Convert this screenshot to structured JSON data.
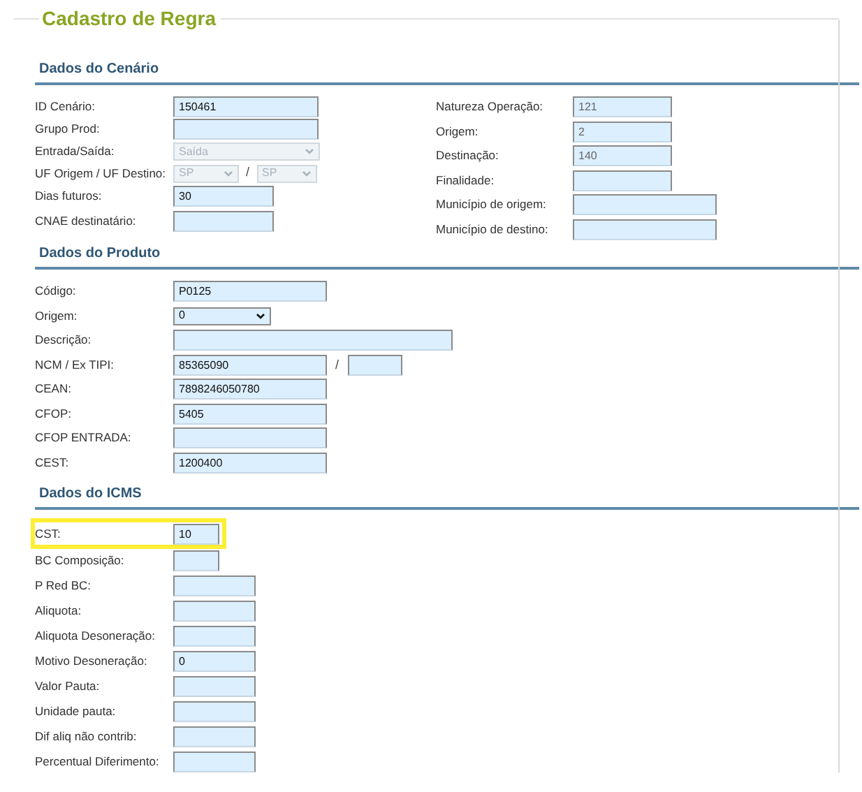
{
  "title": "Cadastro de Regra",
  "sections": [
    {
      "title": "Dados do Cenário",
      "columns": [
        [
          {
            "kind": "text",
            "label": "ID Cenário:",
            "value": "150461"
          },
          {
            "kind": "text",
            "label": "Grupo Prod:"
          },
          {
            "kind": "select",
            "label": "Entrada/Saída:",
            "value": "Saída",
            "disabled": true
          },
          {
            "kind": "select_pair",
            "label": "UF Origem / UF Destino:",
            "value": "SP",
            "separator": "/",
            "value2": "SP",
            "disabled": true
          },
          {
            "kind": "text",
            "label": "Dias futuros:",
            "value": "30"
          },
          {
            "kind": "text",
            "label": "CNAE destinatário:"
          }
        ],
        [
          {
            "kind": "text",
            "label": "Natureza Operação:",
            "value": "121",
            "disabled": true
          },
          {
            "kind": "text",
            "label": "Origem:",
            "value": "2",
            "disabled": true
          },
          {
            "kind": "text",
            "label": "Destinação:",
            "value": "140",
            "disabled": true
          },
          {
            "kind": "text",
            "label": "Finalidade:"
          },
          {
            "kind": "text",
            "label": "Município de origem:"
          },
          {
            "kind": "text",
            "label": "Município de destino:"
          }
        ]
      ]
    },
    {
      "title": "Dados do Produto",
      "columns": [
        [
          {
            "kind": "text",
            "label": "Código:",
            "value": "P0125"
          },
          {
            "kind": "select",
            "label": "Origem:",
            "value": "0",
            "disabled": false
          },
          {
            "kind": "text",
            "label": "Descrição:"
          },
          {
            "kind": "text_pair",
            "label": "NCM / Ex TIPI:",
            "value": "85365090",
            "separator": "/"
          },
          {
            "kind": "text",
            "label": "CEAN:",
            "value": "7898246050780"
          },
          {
            "kind": "text",
            "label": "CFOP:",
            "value": "5405"
          },
          {
            "kind": "text",
            "label": "CFOP ENTRADA:"
          },
          {
            "kind": "text",
            "label": "CEST:",
            "value": "1200400"
          }
        ]
      ]
    },
    {
      "title": "Dados do ICMS",
      "columns": [
        [
          {
            "kind": "text",
            "label": "CST:",
            "value": "10",
            "highlighted": true
          },
          {
            "kind": "text",
            "label": "BC Composição:"
          },
          {
            "kind": "text",
            "label": "P Red BC:"
          },
          {
            "kind": "text",
            "label": "Aliquota:"
          },
          {
            "kind": "text",
            "label": "Aliquota Desoneração:"
          },
          {
            "kind": "text",
            "label": "Motivo Desoneração:",
            "value": "0"
          },
          {
            "kind": "text",
            "label": "Valor Pauta:"
          },
          {
            "kind": "text",
            "label": "Unidade pauta:"
          },
          {
            "kind": "text",
            "label": "Dif aliq não contrib:"
          },
          {
            "kind": "text",
            "label": "Percentual Diferimento:"
          }
        ]
      ]
    }
  ]
}
